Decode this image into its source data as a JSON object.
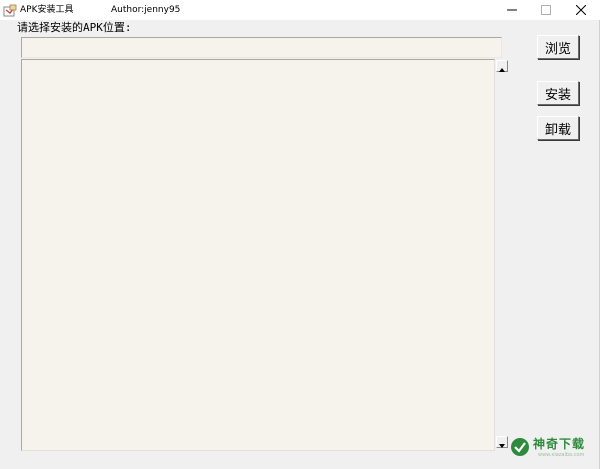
{
  "window": {
    "title": "APK安装工具",
    "author": "Author:jenny95",
    "icon": "apk-tool-icon",
    "controls": [
      "minimize-icon",
      "maximize-icon",
      "close-icon"
    ]
  },
  "form": {
    "prompt_label": "请选择安装的APK位置:",
    "path_value": "",
    "log_value": ""
  },
  "buttons": {
    "browse": "浏览",
    "install": "安装",
    "uninstall": "卸载"
  },
  "watermark": {
    "brand": "神奇下载",
    "url": "www.xiazaiba.com"
  },
  "colors": {
    "field_background": "#f6f2ec",
    "window_background": "#f0f0f0",
    "watermark_green": "#2e8b3e"
  }
}
